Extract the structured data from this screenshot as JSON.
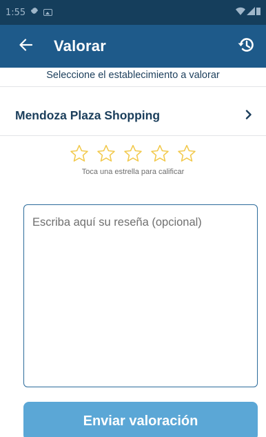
{
  "status_bar": {
    "time": "1:55",
    "icons": [
      "settings-gear-icon",
      "photo-icon",
      "wifi-icon",
      "cell-signal-icon",
      "battery-icon"
    ]
  },
  "app_bar": {
    "title": "Valorar",
    "back_icon": "arrow-left-icon",
    "history_icon": "history-icon"
  },
  "subtitle": "Seleccione el establecimiento a valorar",
  "establishment": {
    "name": "Mendoza Plaza Shopping",
    "chevron_icon": "chevron-right-icon"
  },
  "rating": {
    "stars_total": 5,
    "stars_selected": 0,
    "star_color": "#f2c94c",
    "hint": "Toca una estrella para calificar"
  },
  "review": {
    "value": "",
    "placeholder": "Escriba aquí su reseña (opcional)"
  },
  "submit": {
    "label": "Enviar valoración"
  },
  "colors": {
    "app_bar": "#1e5a8a",
    "status_bar": "#153e5c",
    "primary_text": "#1b3e5b",
    "button": "#5ba7d6"
  }
}
